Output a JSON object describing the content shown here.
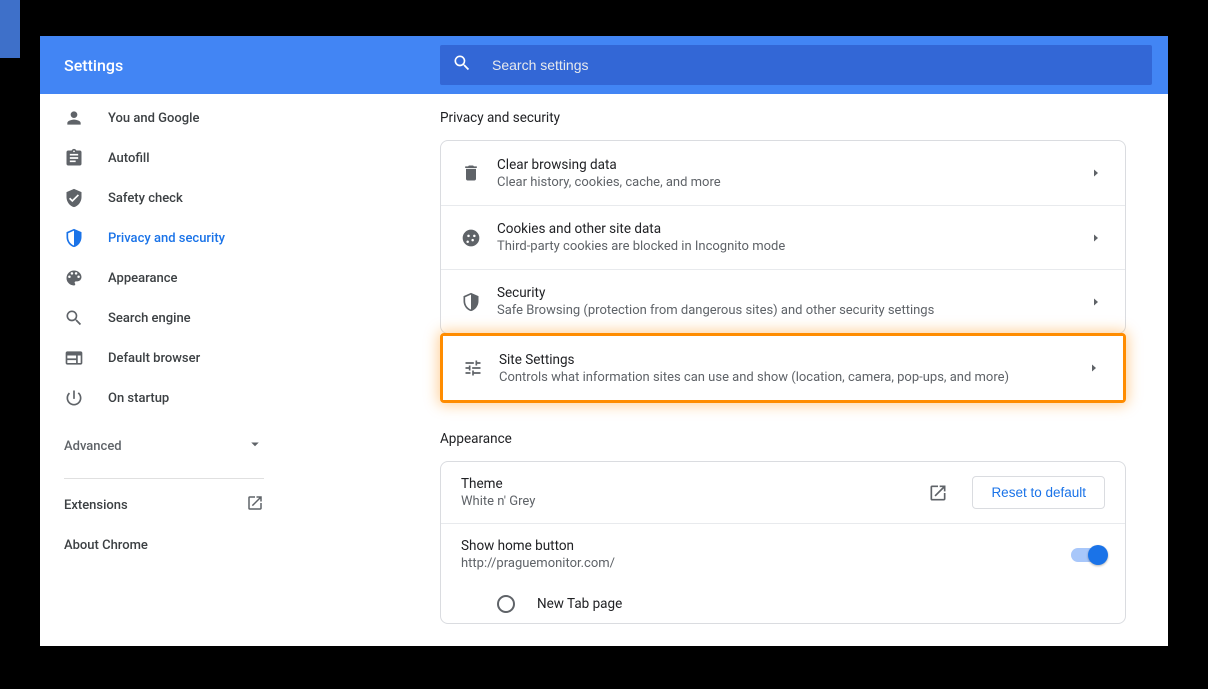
{
  "header": {
    "title": "Settings"
  },
  "search": {
    "placeholder": "Search settings"
  },
  "sidebar": {
    "items": [
      {
        "label": "You and Google"
      },
      {
        "label": "Autofill"
      },
      {
        "label": "Safety check"
      },
      {
        "label": "Privacy and security"
      },
      {
        "label": "Appearance"
      },
      {
        "label": "Search engine"
      },
      {
        "label": "Default browser"
      },
      {
        "label": "On startup"
      }
    ],
    "advanced": "Advanced",
    "extensions": "Extensions",
    "about": "About Chrome"
  },
  "sections": {
    "privacy": {
      "title": "Privacy and security",
      "rows": [
        {
          "title": "Clear browsing data",
          "sub": "Clear history, cookies, cache, and more"
        },
        {
          "title": "Cookies and other site data",
          "sub": "Third-party cookies are blocked in Incognito mode"
        },
        {
          "title": "Security",
          "sub": "Safe Browsing (protection from dangerous sites) and other security settings"
        },
        {
          "title": "Site Settings",
          "sub": "Controls what information sites can use and show (location, camera, pop-ups, and more)"
        }
      ]
    },
    "appearance": {
      "title": "Appearance",
      "theme": {
        "title": "Theme",
        "value": "White n' Grey",
        "reset": "Reset to default"
      },
      "home": {
        "title": "Show home button",
        "url": "http://praguemonitor.com/"
      },
      "newtab": {
        "label": "New Tab page"
      }
    }
  }
}
